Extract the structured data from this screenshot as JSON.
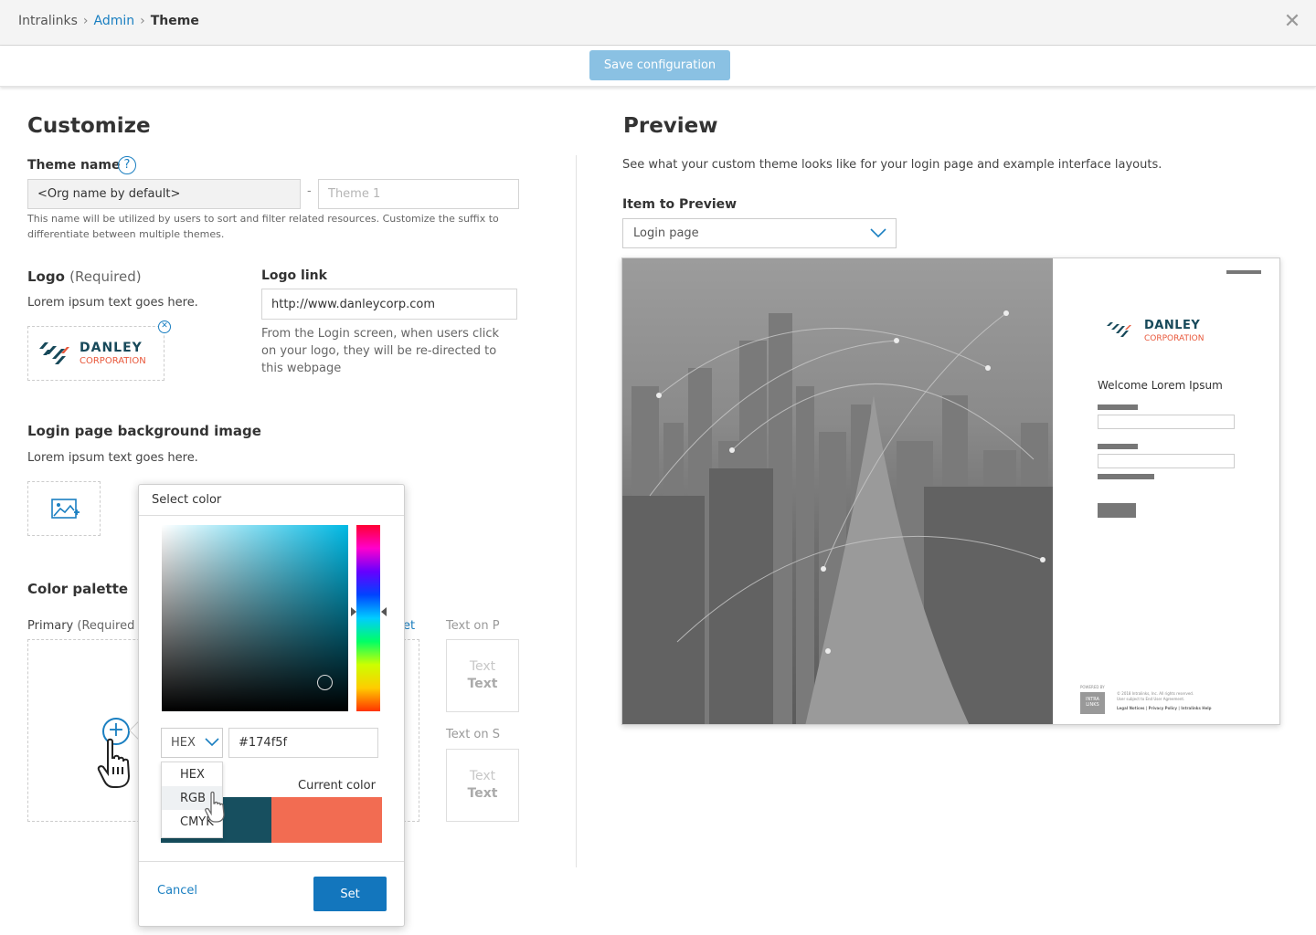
{
  "breadcrumb": {
    "root": "Intralinks",
    "admin": "Admin",
    "current": "Theme"
  },
  "toolbar": {
    "save_label": "Save configuration"
  },
  "customize": {
    "title": "Customize",
    "theme_name_label": "Theme name",
    "theme_name_prefix": "<Org name by default>",
    "theme_name_dash": "-",
    "theme_name_suffix_placeholder": "Theme 1",
    "theme_name_help": "This name will be utilized by users to sort and filter related resources. Customize the suffix to differentiate between multiple themes.",
    "logo_label": "Logo",
    "logo_required": "(Required)",
    "logo_desc": "Lorem ipsum text goes here.",
    "logo_link_label": "Logo link",
    "logo_link_value": "http://www.danleycorp.com",
    "logo_link_help": "From the Login screen, when users click on your logo, they will be re-directed to this webpage",
    "bg_label": "Login page background image",
    "bg_desc": "Lorem ipsum text goes here.",
    "palette_label": "Color palette",
    "primary_label": "Primary",
    "primary_required": "(Required",
    "reset_partial": "et",
    "text_on_primary": "Text on P",
    "text_on_secondary": "Text on S",
    "sample_text": "Text",
    "sample_text_bold": "Text"
  },
  "logo": {
    "name": "DANLEY",
    "sub": "CORPORATION"
  },
  "picker": {
    "title": "Select color",
    "format_selected": "HEX",
    "hex_value": "#174f5f",
    "current_color_label": "Current color",
    "new_color": "#174f5f",
    "current_color": "#f26c52",
    "formats": [
      "HEX",
      "RGB",
      "CMYK"
    ],
    "cancel_label": "Cancel",
    "set_label": "Set"
  },
  "preview": {
    "title": "Preview",
    "desc": "See what your custom theme looks like for your login page and example interface layouts.",
    "item_label": "Item to Preview",
    "item_value": "Login page",
    "welcome": "Welcome Lorem Ipsum",
    "powered_by": "POWERED BY",
    "il_logo": "INTRA LINKS",
    "copyright": "© 2018 Intralinks, Inc. All rights reserved.",
    "agreement": "User subject to End User Agreement.",
    "footer_links": "Legal Notices | Privacy Policy | Intralinks Help"
  },
  "colors": {
    "accent": "#1a7fc1",
    "button": "#1376bd",
    "save_disabled": "#8ac1e3"
  }
}
